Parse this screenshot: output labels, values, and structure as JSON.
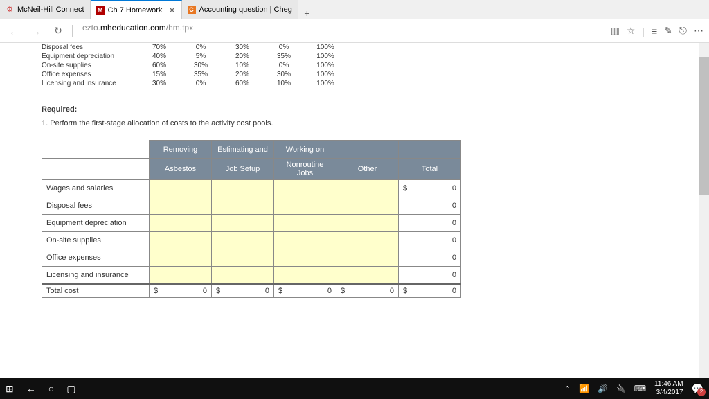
{
  "tabs": [
    {
      "icon": "⚙",
      "label": "McNeil-Hill Connect",
      "iconColor": "#d04040"
    },
    {
      "icon": "M",
      "label": "Ch 7 Homework",
      "iconColor": "#fff",
      "iconBg": "#b00000"
    },
    {
      "icon": "C",
      "label": "Accounting question | Cheg",
      "iconColor": "#fff",
      "iconBg": "#e87722"
    }
  ],
  "url": {
    "domain": "ezto.mheducation.com",
    "path": "/hm.tpx"
  },
  "pctRows": [
    {
      "label": "Disposal fees",
      "c": [
        "70%",
        "0%",
        "30%",
        "0%",
        "100%"
      ]
    },
    {
      "label": "Equipment depreciation",
      "c": [
        "40%",
        "5%",
        "20%",
        "35%",
        "100%"
      ]
    },
    {
      "label": "On-site supplies",
      "c": [
        "60%",
        "30%",
        "10%",
        "0%",
        "100%"
      ]
    },
    {
      "label": "Office expenses",
      "c": [
        "15%",
        "35%",
        "20%",
        "30%",
        "100%"
      ]
    },
    {
      "label": "Licensing and insurance",
      "c": [
        "30%",
        "0%",
        "60%",
        "10%",
        "100%"
      ]
    }
  ],
  "requiredLabel": "Required:",
  "requiredText": "1.  Perform the first-stage allocation of costs to the activity cost pools.",
  "headerRow1": [
    "Removing",
    "Estimating and",
    "Working on"
  ],
  "headerRow2": [
    "Asbestos",
    "Job Setup",
    "Nonroutine Jobs",
    "Other",
    "Total"
  ],
  "mainRows": [
    {
      "label": "Wages and salaries",
      "totCur": "$",
      "tot": "0"
    },
    {
      "label": "Disposal fees",
      "totCur": "",
      "tot": "0"
    },
    {
      "label": "Equipment depreciation",
      "totCur": "",
      "tot": "0"
    },
    {
      "label": "On-site supplies",
      "totCur": "",
      "tot": "0"
    },
    {
      "label": "Office expenses",
      "totCur": "",
      "tot": "0"
    },
    {
      "label": "Licensing and insurance",
      "totCur": "",
      "tot": "0"
    }
  ],
  "totalRow": {
    "label": "Total cost",
    "cells": [
      {
        "c": "$",
        "v": "0"
      },
      {
        "c": "$",
        "v": "0"
      },
      {
        "c": "$",
        "v": "0"
      },
      {
        "c": "$",
        "v": "0"
      },
      {
        "c": "$",
        "v": "0"
      }
    ]
  },
  "clock": {
    "time": "11:46 AM",
    "date": "3/4/2017"
  },
  "notifCount": "2"
}
